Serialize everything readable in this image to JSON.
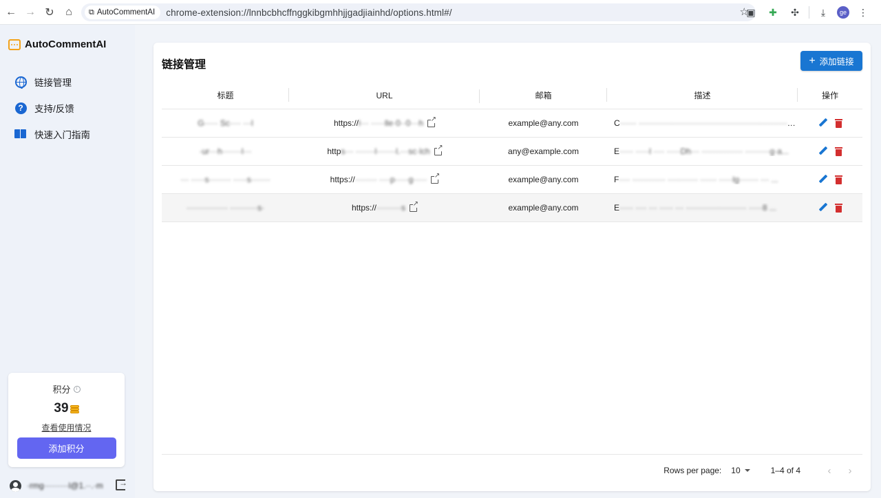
{
  "browser": {
    "site_chip": "AutoCommentAI",
    "url": "chrome-extension://lnnbcbhcffnggkibgmhhjjgadjiainhd/options.html#/",
    "profile_initials": "ge"
  },
  "sidebar": {
    "brand": "AutoCommentAI",
    "items": [
      {
        "label": "链接管理",
        "icon": "globe-icon"
      },
      {
        "label": "支持/反馈",
        "icon": "help-icon"
      },
      {
        "label": "快速入门指南",
        "icon": "book-icon"
      }
    ],
    "points": {
      "label": "积分",
      "value": "39",
      "usage_link": "查看使用情况",
      "add_button": "添加积分"
    },
    "user_email": "·rmg·········l@1.··.·m"
  },
  "main": {
    "title": "链接管理",
    "add_button": "添加链接",
    "columns": [
      "标题",
      "URL",
      "邮箱",
      "描述",
      "操作"
    ],
    "rows": [
      {
        "title": "G····· Sc···· ···l",
        "url_prefix": "https://",
        "url_rest": "l··· ·····lle·0··0···h",
        "email": "example@any.com",
        "desc_prefix": "C",
        "desc_rest": "······ ·····························································ya..."
      },
      {
        "title": "·ur···h·······l···",
        "url_prefix": "http",
        "url_rest": "s··· ·······l·······l.···sc·lch",
        "email": "any@example.com",
        "desc_prefix": "E",
        "desc_rest": "····· ·····l ···· ·····Dh··· ··············· ·········g·a..."
      },
      {
        "title": "··· ·····s········ ·····s·······",
        "url_prefix": "https://",
        "url_rest": "········ ····p·····g·····",
        "email": "example@any.com",
        "desc_prefix": "F",
        "desc_rest": "···· ············ ··········· ······ ·····lg······· ··· ..."
      },
      {
        "title": "··············· ··········s·",
        "url_prefix": "https://",
        "url_rest": "·········s",
        "email": "example@any.com",
        "desc_prefix": "E",
        "desc_rest": "····· ···· ··· ····· ··· ······················ ·····8 ..."
      }
    ],
    "pagination": {
      "rows_per_page_label": "Rows per page:",
      "rows_per_page": "10",
      "range": "1–4 of 4"
    }
  }
}
